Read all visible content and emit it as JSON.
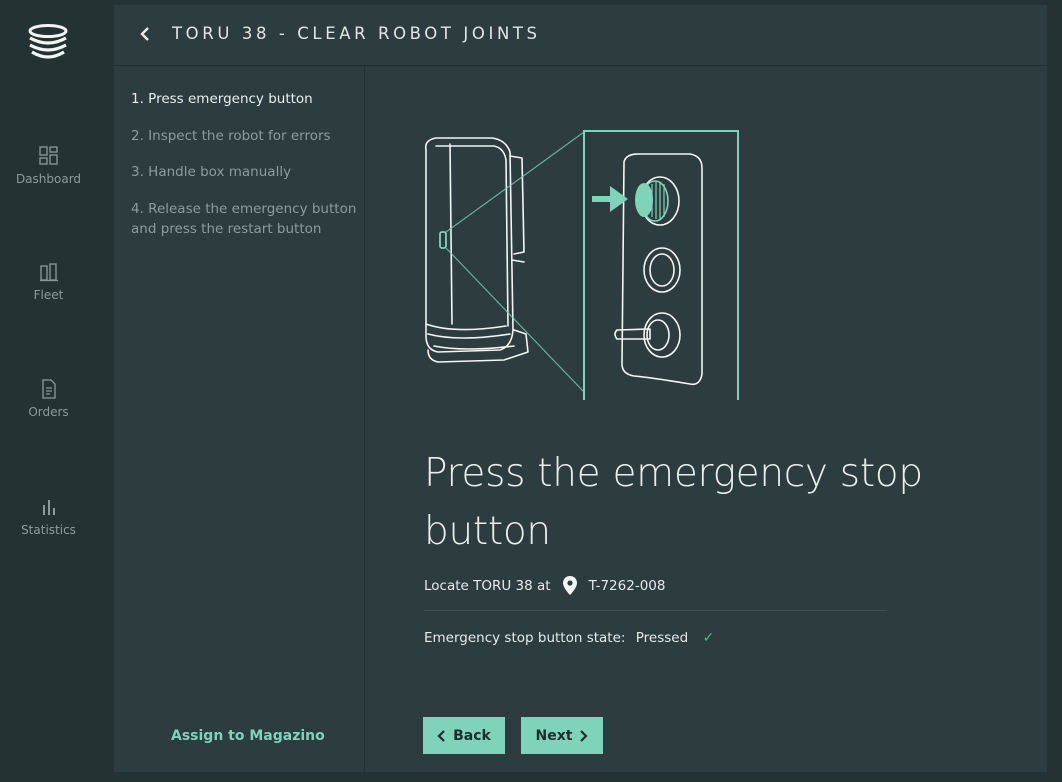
{
  "nav": {
    "items": [
      {
        "label": "Dashboard",
        "icon": "dashboard-icon"
      },
      {
        "label": "Fleet",
        "icon": "fleet-icon"
      },
      {
        "label": "Orders",
        "icon": "orders-icon"
      },
      {
        "label": "Statistics",
        "icon": "statistics-icon"
      }
    ]
  },
  "header": {
    "title": "TORU 38 - CLEAR ROBOT JOINTS"
  },
  "steps": [
    "1. Press emergency button",
    "2. Inspect the robot for errors",
    "3. Handle box manually",
    "4. Release the emergency button and press the restart button"
  ],
  "assign_label": "Assign to Magazino",
  "content": {
    "headline": "Press the emergency stop button",
    "locate_label": "Locate TORU 38 at",
    "location_code": "T-7262-008",
    "state_label": "Emergency stop button state:",
    "state_value": "Pressed"
  },
  "buttons": {
    "back": "Back",
    "next": "Next"
  },
  "colors": {
    "accent": "#7fd3bb",
    "background": "#253234",
    "panel": "#2d3c3e",
    "status_ok": "#39c77b"
  }
}
